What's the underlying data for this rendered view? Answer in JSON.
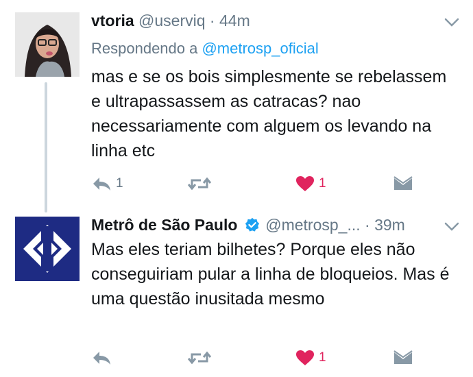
{
  "tweets": [
    {
      "name": "vtoria",
      "handle": "@userviq",
      "separator": "·",
      "time": "44m",
      "reply_prefix": "Respondendo a ",
      "reply_to": "@metrosp_oficial",
      "text": "mas e se os bois simplesmente se rebelassem e ultrapassassem as catracas? nao necessariamente com alguem os levando na linha etc",
      "actions": {
        "reply_count": "1",
        "retweet_count": "",
        "like_count": "1"
      }
    },
    {
      "name": "Metrô de São Paulo",
      "verified": true,
      "handle": "@metrosp_...",
      "separator": "·",
      "time": "39m",
      "text": "Mas eles teriam bilhetes? Porque eles não conseguiriam pular a linha de bloqueios. Mas é uma questão inusitada mesmo",
      "actions": {
        "reply_count": "",
        "retweet_count": "",
        "like_count": "1"
      }
    }
  ],
  "colors": {
    "text": "#14171a",
    "secondary": "#657786",
    "link": "#1da1f2",
    "like": "#e0245e",
    "icon": "#8899a6",
    "metro_logo_bg": "#1e2b83",
    "thread_line": "#ccd6dd"
  },
  "icons": {
    "reply": "reply-icon",
    "retweet": "retweet-icon",
    "like": "heart-icon",
    "dm": "envelope-icon",
    "more": "chevron-down-icon",
    "verified": "verified-badge-icon"
  }
}
